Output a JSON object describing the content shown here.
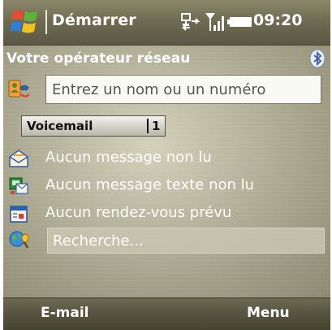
{
  "titlebar": {
    "title": "Démarrer",
    "clock": "09:20"
  },
  "today": {
    "operator": "Votre opérateur réseau",
    "contact_placeholder": "Entrez un nom ou un numéro",
    "voicemail": {
      "label": "Voicemail",
      "count": "1"
    },
    "email_status": "Aucun message non lu",
    "sms_status": "Aucun message texte non lu",
    "calendar_status": "Aucun rendez-vous prévu",
    "search_placeholder": "Recherche..."
  },
  "softkeys": {
    "left": "E-mail",
    "right": "Menu"
  },
  "colors": {
    "titlebar": "#6f6c53",
    "today_background": "#bab7a0",
    "softkey_bar": "#55533f"
  }
}
